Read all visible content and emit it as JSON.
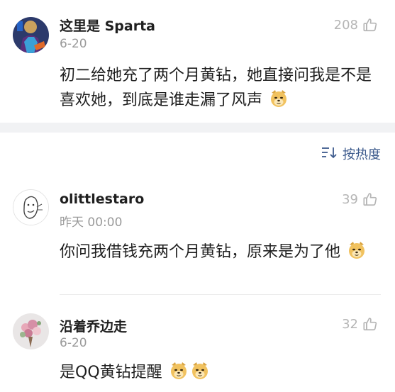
{
  "colors": {
    "accent_blue": "#3c5a8c",
    "meta_gray": "#9a9a9a",
    "like_gray": "#b5b5b5",
    "band_gray": "#f1f2f4"
  },
  "top_comment": {
    "user": "这里是 Sparta",
    "time": "6-20",
    "likes": "208",
    "text": "初二给她充了两个月黄钻，她直接问我是不是喜欢她，到底是谁走漏了风声",
    "emoji": [
      "doge-emoji"
    ]
  },
  "sort": {
    "icon": "sort-icon",
    "label": "按热度"
  },
  "comments": [
    {
      "user": "olittlestaro",
      "time": "昨天 00:00",
      "likes": "39",
      "text": "你问我借钱充两个月黄钻，原来是为了他",
      "emoji": [
        "doge-emoji"
      ]
    },
    {
      "user": "沿着乔边走",
      "time": "6-20",
      "likes": "32",
      "text": "是QQ黄钻提醒",
      "emoji": [
        "doge-emoji",
        "doge-emoji"
      ]
    }
  ],
  "icons": {
    "like": "thumbs-up-icon"
  }
}
